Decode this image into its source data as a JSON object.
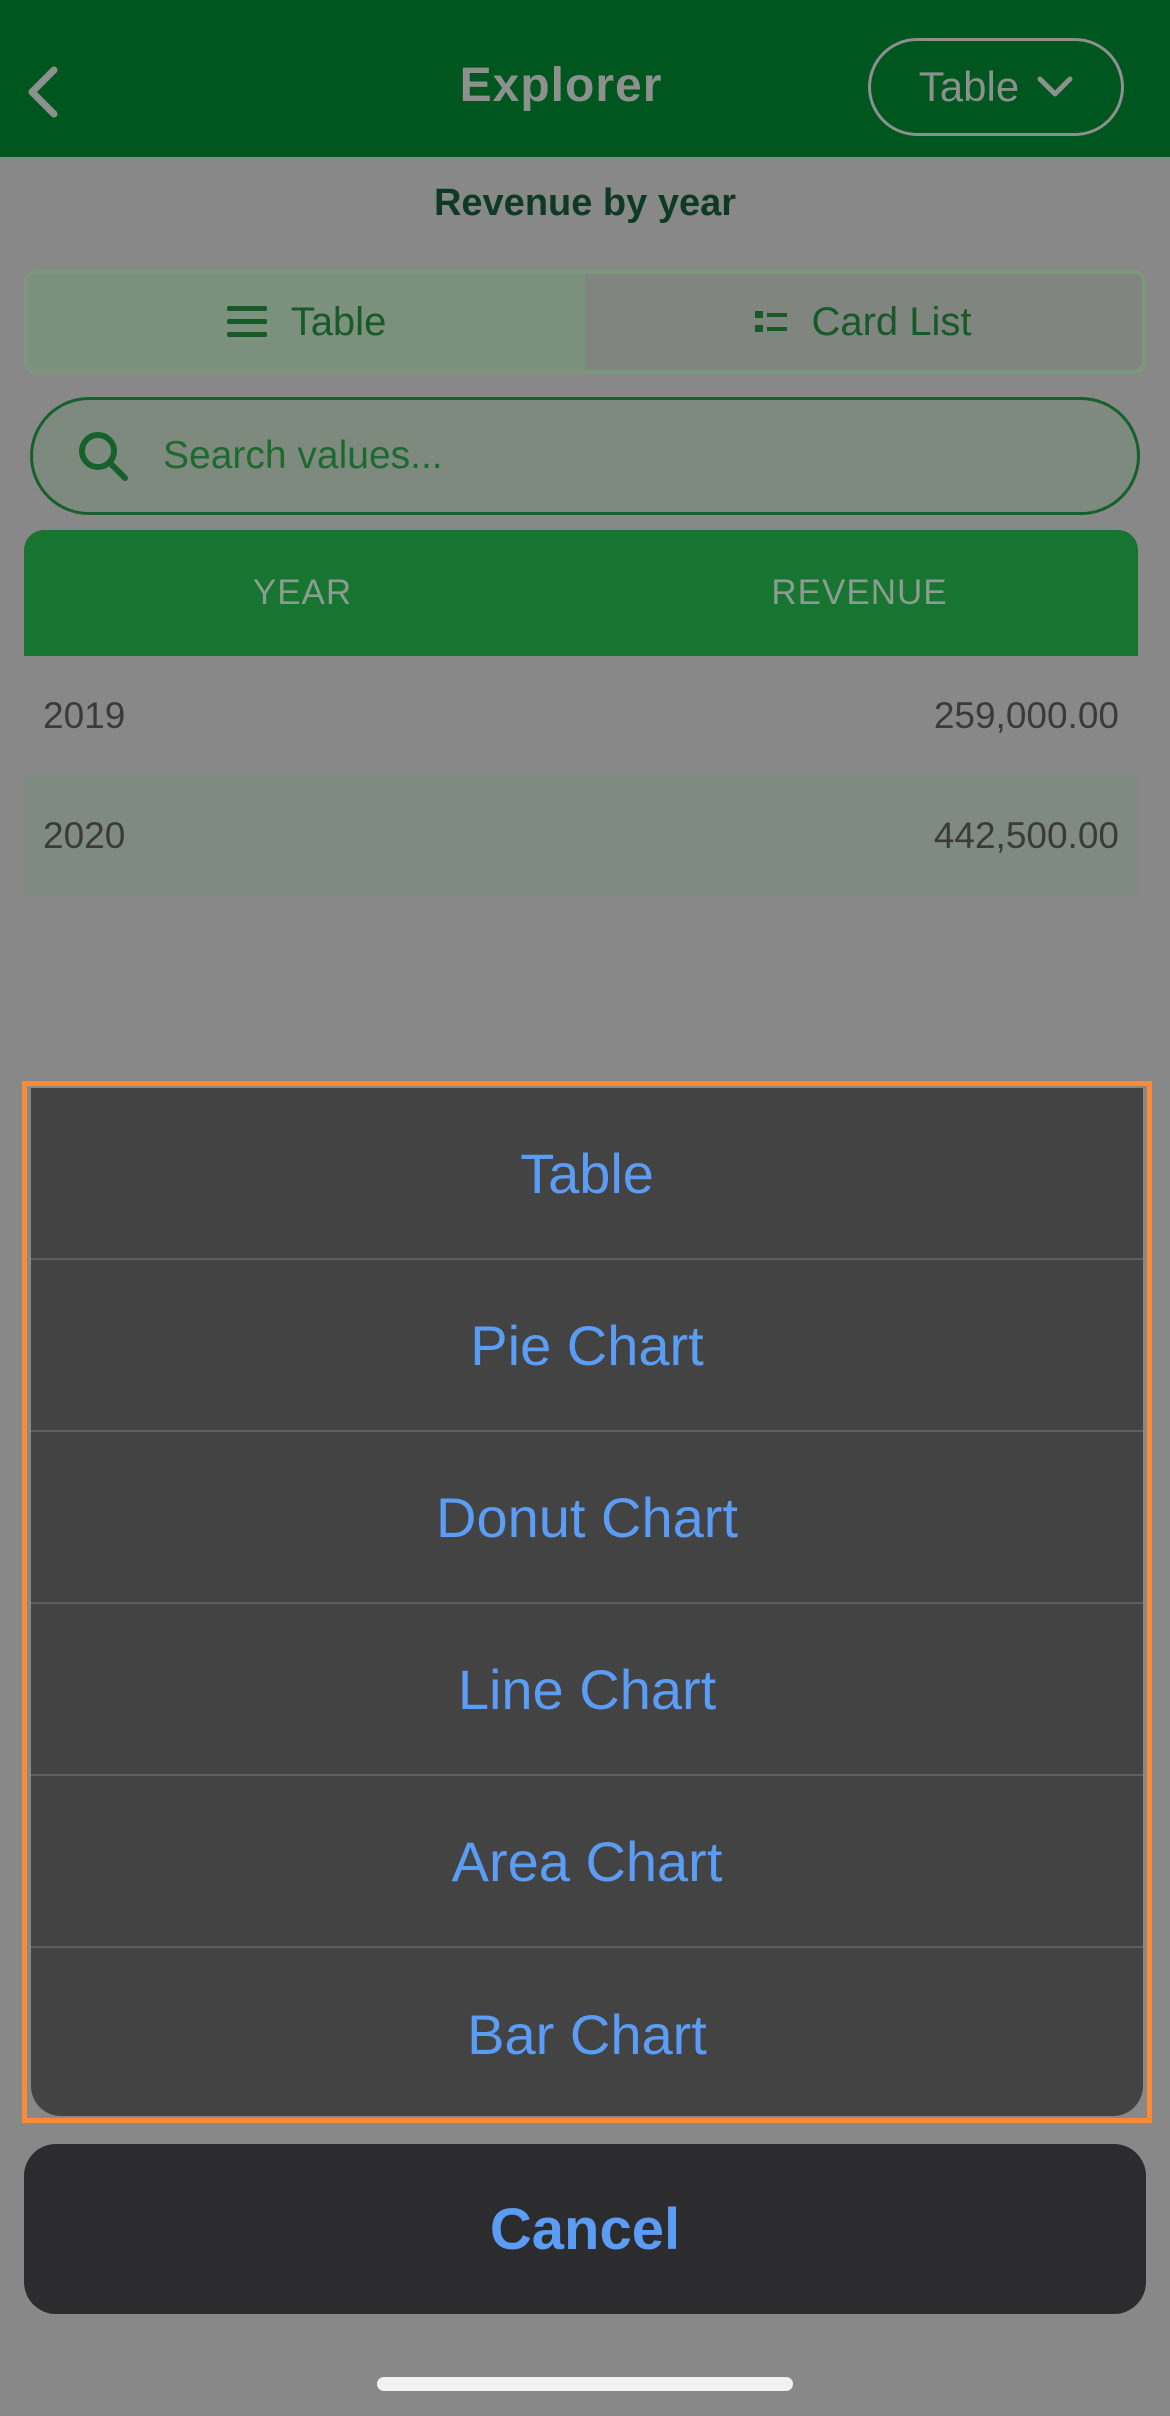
{
  "header": {
    "title": "Explorer",
    "view_select_label": "Table"
  },
  "page_title": "Revenue by year",
  "segments": [
    {
      "label": "Table",
      "active": true
    },
    {
      "label": "Card List",
      "active": false
    }
  ],
  "search": {
    "placeholder": "Search values..."
  },
  "table": {
    "columns": [
      "YEAR",
      "REVENUE"
    ],
    "rows": [
      {
        "year": "2019",
        "revenue": "259,000.00"
      },
      {
        "year": "2020",
        "revenue": "442,500.00"
      }
    ]
  },
  "action_sheet": {
    "options": [
      "Table",
      "Pie Chart",
      "Donut Chart",
      "Line Chart",
      "Area Chart",
      "Bar Chart"
    ],
    "cancel_label": "Cancel"
  },
  "colors": {
    "header_bg": "#00561f",
    "accent_green": "#187431",
    "action_blue": "#5b9cf4",
    "highlight_orange": "#ff8a35"
  }
}
